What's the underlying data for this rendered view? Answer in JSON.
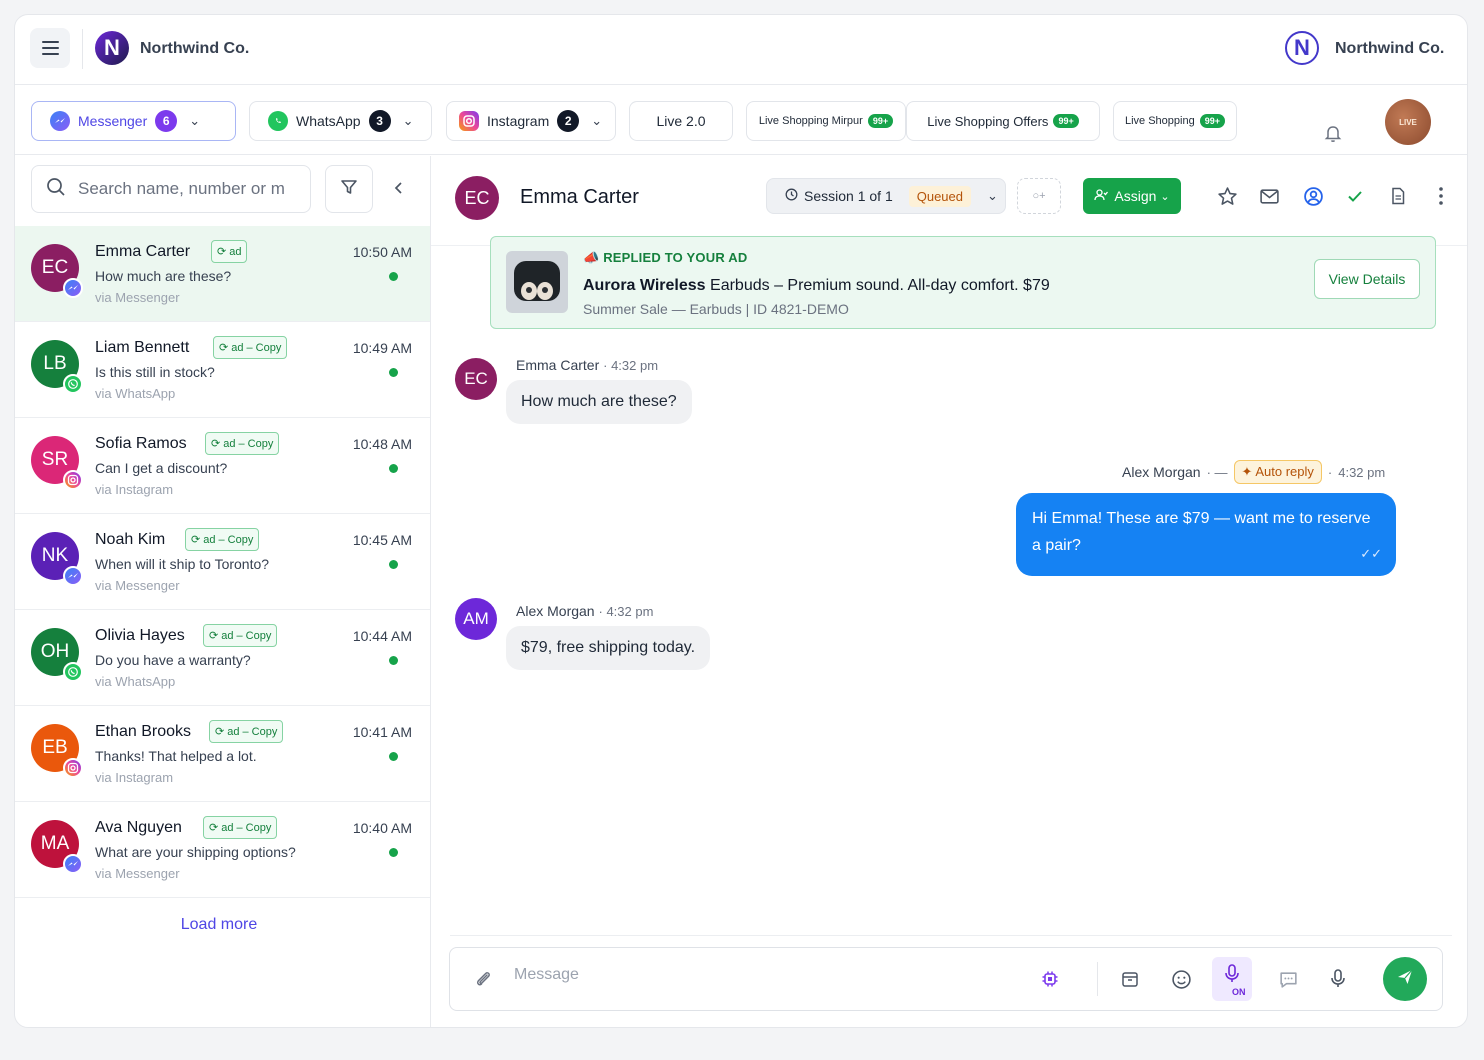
{
  "top": {
    "brand_left": "Northwind Co.",
    "brand_right": "Northwind Co.",
    "logo_letter": "N",
    "profile_text": "LIVE"
  },
  "tabs": [
    {
      "label": "Messenger",
      "count": "6",
      "count_color": "#7c3aed"
    },
    {
      "label": "WhatsApp",
      "count": "3",
      "count_color": "#111827"
    },
    {
      "label": "Instagram",
      "count": "2",
      "count_color": "#111827"
    },
    {
      "label": "Live 2.0"
    },
    {
      "label": "Live Shopping Mirpur",
      "badge": "99+"
    },
    {
      "label": "Live Shopping Offers",
      "badge": "99+"
    },
    {
      "label": "Live Shopping",
      "badge": "99+"
    }
  ],
  "search": {
    "placeholder": "Search name, number or m"
  },
  "conversations": [
    {
      "initials": "EC",
      "name": "Emma Carter",
      "tag": "ad",
      "preview": "How much are these?",
      "via": "via Messenger",
      "time": "10:50 AM",
      "color": "#8b1e62",
      "channel": "messenger"
    },
    {
      "initials": "LB",
      "name": "Liam Bennett",
      "tag": "ad – Copy",
      "preview": "Is this still in stock?",
      "via": "via WhatsApp",
      "time": "10:49 AM",
      "color": "#15803d",
      "channel": "whatsapp"
    },
    {
      "initials": "SR",
      "name": "Sofia Ramos",
      "tag": "ad – Copy",
      "preview": "Can I get a discount?",
      "via": "via Instagram",
      "time": "10:48 AM",
      "color": "#db2777",
      "channel": "instagram"
    },
    {
      "initials": "NK",
      "name": "Noah Kim",
      "tag": "ad – Copy",
      "preview": "When will it ship to Toronto?",
      "via": "via Messenger",
      "time": "10:45 AM",
      "color": "#5b21b6",
      "channel": "messenger"
    },
    {
      "initials": "OH",
      "name": "Olivia Hayes",
      "tag": "ad – Copy",
      "preview": "Do you have a warranty?",
      "via": "via WhatsApp",
      "time": "10:44 AM",
      "color": "#15803d",
      "channel": "whatsapp"
    },
    {
      "initials": "EB",
      "name": "Ethan Brooks",
      "tag": "ad – Copy",
      "preview": "Thanks! That helped a lot.",
      "via": "via Instagram",
      "time": "10:41 AM",
      "color": "#ea580c",
      "channel": "instagram"
    },
    {
      "initials": "MA",
      "name": "Ava Nguyen",
      "tag": "ad – Copy",
      "preview": "What are your shipping options?",
      "via": "via Messenger",
      "time": "10:40 AM",
      "color": "#be123c",
      "channel": "messenger"
    }
  ],
  "load_more": "Load more",
  "chat": {
    "initials": "EC",
    "name": "Emma Carter",
    "session": "Session 1 of 1",
    "status": "Queued",
    "assign": "Assign",
    "ad": {
      "label": "REPLIED TO YOUR AD",
      "title_bold": "Aurora Wireless",
      "title_rest": " Earbuds – Premium sound. All-day comfort. $79",
      "sub": "Summer Sale — Earbuds | ID 4821-DEMO",
      "button": "View Details"
    },
    "messages": [
      {
        "initials": "EC",
        "sender": "Emma Carter",
        "time": "4:32 pm",
        "text": "How much are these?"
      },
      {
        "sender": "Alex Morgan",
        "auto_reply": "Auto reply",
        "time": "4:32 pm",
        "text": "Hi Emma! These are $79 — want me to reserve a pair?"
      },
      {
        "initials": "AM",
        "sender": "Alex Morgan",
        "time": "4:32 pm",
        "text": "$79, free shipping today."
      }
    ]
  },
  "composer": {
    "placeholder": "Message",
    "mic_status": "ON"
  }
}
